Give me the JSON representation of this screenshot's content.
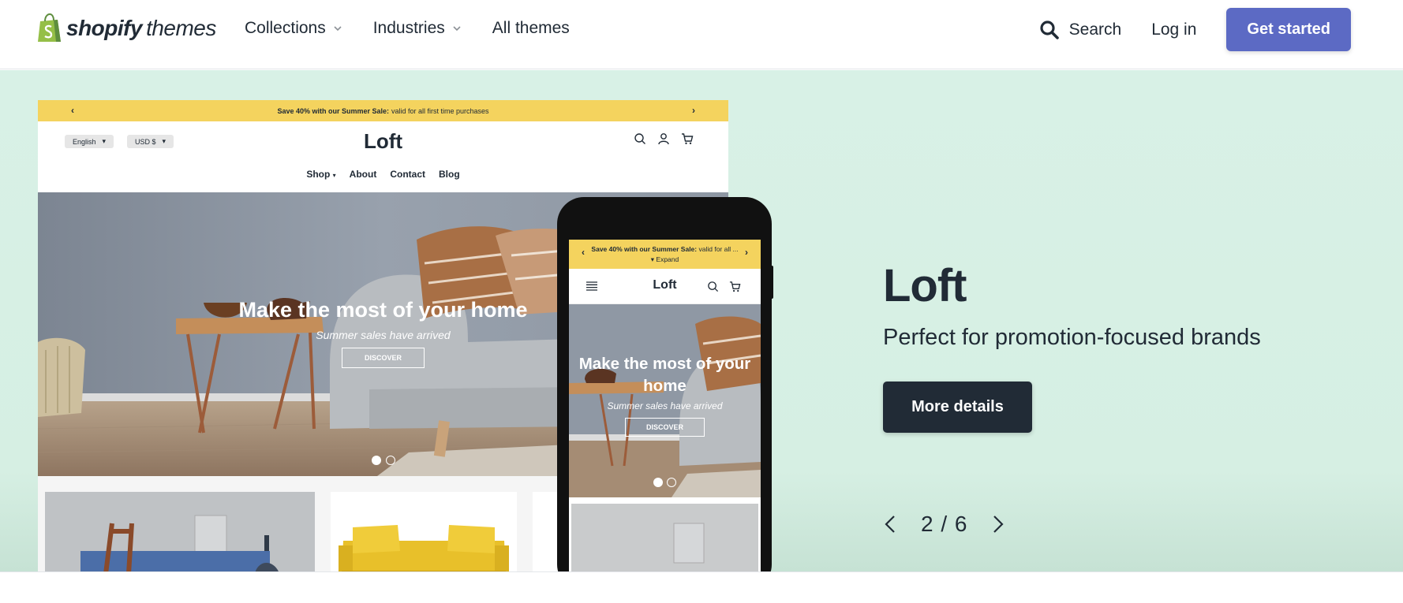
{
  "nav": {
    "logo_bold": "shopify",
    "logo_light": "themes",
    "links": [
      "Collections",
      "Industries",
      "All themes"
    ],
    "search_label": "Search",
    "login_label": "Log in",
    "cta_label": "Get started"
  },
  "colors": {
    "brand_green": "#95bf47",
    "cta_purple": "#5c6ac4",
    "hero_bg": "#d8f1e6",
    "dark": "#212b36",
    "announce_yellow": "#f4d35e"
  },
  "preview": {
    "announce_bold": "Save 40% with our Summer Sale:",
    "announce_rest": "valid for all first time purchases",
    "mobile_announce_rest": "valid for all ...",
    "expand_label": "Expand",
    "lang": "English",
    "currency": "USD $",
    "store_name": "Loft",
    "menu": [
      "Shop",
      "About",
      "Contact",
      "Blog"
    ],
    "hero_title": "Make the most of your home",
    "mobile_hero_title": "Make the most of your home",
    "hero_subtitle": "Summer sales have arrived",
    "hero_button": "DISCOVER"
  },
  "theme": {
    "name": "Loft",
    "tagline": "Perfect for promotion-focused brands",
    "details_label": "More details"
  },
  "pager": {
    "current": 2,
    "total": 6,
    "label": "2 / 6"
  }
}
